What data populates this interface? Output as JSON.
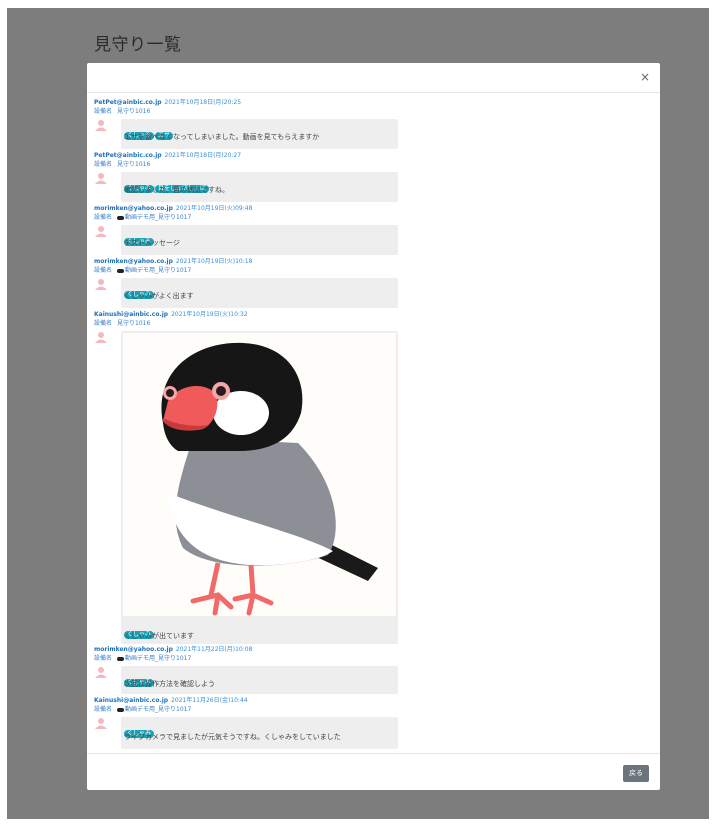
{
  "page": {
    "title": "見守り一覧"
  },
  "modal": {
    "close_label": "×",
    "back_label": "戻る",
    "device_label": "設備名"
  },
  "messages": [
    {
      "sender": "PetPet@ainbic.co.jp",
      "time": "2021年10月18日(月)20:25",
      "device": "見守り1016",
      "device_icon": false,
      "tags": [
        "くしゃみ",
        "エサ"
      ],
      "text": "エサを食べなくなってしまいました。動画を見てもらえますか"
    },
    {
      "sender": "PetPet@ainbic.co.jp",
      "time": "2021年10月18日(月)20:27",
      "device": "見守り1016",
      "device_icon": false,
      "tags": [
        "くしゃみ",
        "目をしょぼしょぼ"
      ],
      "text": "確認しました。目の病気ですね。"
    },
    {
      "sender": "morimken@yahoo.co.jp",
      "time": "2021年10月19日(火)09:48",
      "device": "動画デモ用_見守り1017",
      "device_icon": true,
      "tags": [
        "くしゃみ"
      ],
      "text": "テストメッセージ"
    },
    {
      "sender": "morimken@yahoo.co.jp",
      "time": "2021年10月19日(火)10:18",
      "device": "動画デモ用_見守り1017",
      "device_icon": true,
      "tags": [
        "くしゃみ"
      ],
      "text": "くしゃみがよく出ます"
    },
    {
      "sender": "Kainushi@ainbic.co.jp",
      "time": "2021年10月19日(火)10:32",
      "device": "見守り1016",
      "device_icon": false,
      "tags": [
        "くしゃみ"
      ],
      "text": "くしゃみが出ています",
      "image": "java-sparrow-illustration"
    },
    {
      "sender": "morimken@yahoo.co.jp",
      "time": "2021年11月22日(月)10:08",
      "device": "動画デモ用_見守り1017",
      "device_icon": true,
      "tags": [
        "くしゃみ"
      ],
      "text": "次回は操作方法を確認しよう"
    },
    {
      "sender": "Kainushi@ainbic.co.jp",
      "time": "2021年11月26日(金)10:44",
      "device": "動画デモ用_見守り1017",
      "device_icon": true,
      "tags": [
        "くしゃみ"
      ],
      "text": "ライブカメラで見ましたが元気そうですね。くしゃみをしていました"
    }
  ],
  "colors": {
    "accent": "#17a2b8",
    "link": "#1f6fb8",
    "overlay": "#7d7d7d",
    "bubble": "#eeeeee",
    "avatar": "#f4b8bf"
  }
}
